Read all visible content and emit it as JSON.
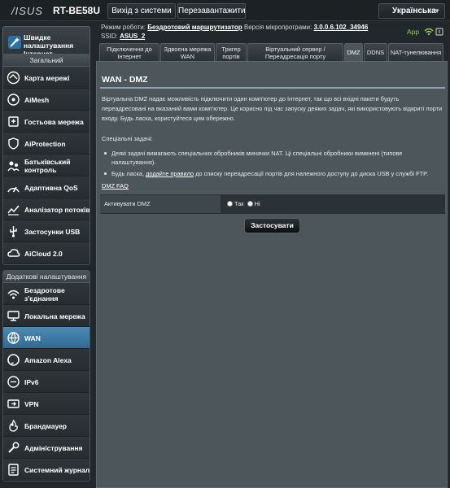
{
  "header": {
    "logo": "/ISUS",
    "model": "RT-BE58U",
    "logout_label": "Вихід з системи",
    "reboot_label": "Перезавантажити",
    "language": "Українська"
  },
  "status": {
    "mode_label": "Режим роботи:",
    "mode_value": "Бездротовий маршрутизатор",
    "firmware_label": "Версія мікропрограми:",
    "firmware_value": "3.0.0.6.102_34946",
    "ssid_label": "SSID:",
    "ssid_value": "ASUS_2",
    "app_label": "App"
  },
  "sidebar": {
    "quick_label": "Швидке налаштування Інтернет",
    "general_header": "Загальний",
    "general_items": [
      {
        "label": "Карта мережі",
        "icon": "network-map-icon"
      },
      {
        "label": "AiMesh",
        "icon": "aimesh-icon"
      },
      {
        "label": "Гостьова мережа",
        "icon": "guest-network-icon"
      },
      {
        "label": "AiProtection",
        "icon": "aiprotection-icon"
      },
      {
        "label": "Батьківський контроль",
        "icon": "parental-control-icon"
      },
      {
        "label": "Адаптивна QoS",
        "icon": "qos-icon"
      },
      {
        "label": "Аналізатор потоків",
        "icon": "traffic-analyzer-icon"
      },
      {
        "label": "Застосунки USB",
        "icon": "usb-icon"
      },
      {
        "label": "AiCloud 2.0",
        "icon": "aicloud-icon"
      }
    ],
    "advanced_header": "Додаткові налаштування",
    "advanced_items": [
      {
        "label": "Бездротове з'єднання",
        "icon": "wireless-icon"
      },
      {
        "label": "Локальна мережа",
        "icon": "lan-icon"
      },
      {
        "label": "WAN",
        "icon": "wan-globe-icon"
      },
      {
        "label": "Amazon Alexa",
        "icon": "alexa-icon"
      },
      {
        "label": "IPv6",
        "icon": "ipv6-icon"
      },
      {
        "label": "VPN",
        "icon": "vpn-icon"
      },
      {
        "label": "Брандмауер",
        "icon": "firewall-icon"
      },
      {
        "label": "Адміністрування",
        "icon": "administration-icon"
      },
      {
        "label": "Системний журнал",
        "icon": "system-log-icon"
      }
    ]
  },
  "tabs": [
    {
      "label": "Підключення до Інтернет"
    },
    {
      "label": "Здвоєна мережа WAN"
    },
    {
      "label": "Тригер портів"
    },
    {
      "label": "Віртуальний сервер / Переадресація порту"
    },
    {
      "label": "DMZ"
    },
    {
      "label": "DDNS"
    },
    {
      "label": "NAT-тунелювання"
    }
  ],
  "content": {
    "title": "WAN - DMZ",
    "description": "Віртуальна DMZ надає можливість підключити один комп'ютер до Інтернет, так що всі вхідні пакети будуть переадресовані на вказаний вами комп'ютер. Це корисно під час запуску деяких задач, які використовують відкриті порти входу. Будь ласка, користуйтеся цим обережно.",
    "special_tasks": "Спеціальні задачі:",
    "bullet1": "Деякі задачі вимагають спеціальних обробників миначки NAT. Ці спеціальні обробники вимкнені (типове налаштування).",
    "bullet2_pre": "Будь ласка, ",
    "bullet2_link": "додайте правило",
    "bullet2_post": " до списку переадресації портів для належного доступу до диска USB у службі FTP.",
    "faq_link": "DMZ FAQ",
    "enable_label": "Активувати DMZ",
    "radio_yes": "Так",
    "radio_no": "Ні",
    "apply_label": "Застосувати"
  }
}
